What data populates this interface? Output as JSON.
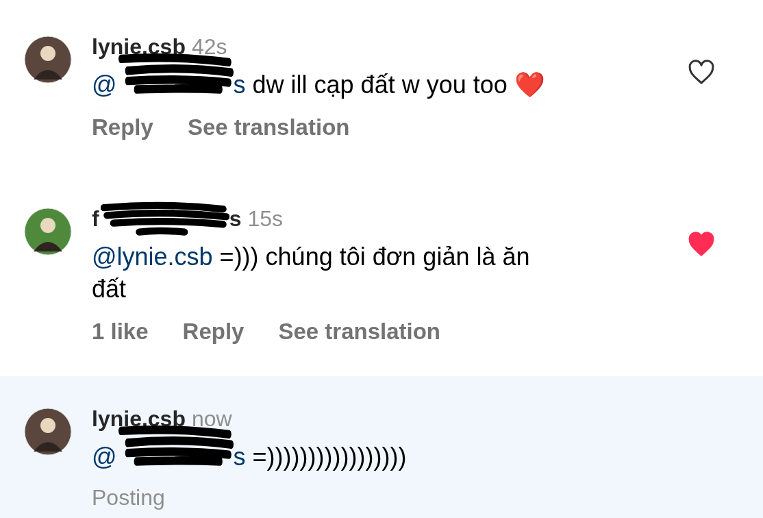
{
  "comments": [
    {
      "avatar": {
        "color": "#5a463c"
      },
      "username": [
        {
          "kind": "text",
          "text": "lynie.csb"
        }
      ],
      "time": "42s",
      "body": [
        {
          "kind": "mention",
          "text": "@"
        },
        {
          "kind": "redacted"
        },
        {
          "kind": "mention",
          "text": "s"
        },
        {
          "kind": "text",
          "text": " dw ill cạp đất w you too "
        },
        {
          "kind": "emoji",
          "text": "❤️"
        }
      ],
      "actions": [
        "Reply",
        "See translation"
      ],
      "like_button": {
        "liked": false
      },
      "highlighted": false
    },
    {
      "avatar": {
        "color": "#4f8a3c"
      },
      "username": [
        {
          "kind": "text",
          "text": "f"
        },
        {
          "kind": "redacted"
        },
        {
          "kind": "text",
          "text": "s"
        }
      ],
      "time": "15s",
      "body": [
        {
          "kind": "mention",
          "text": "@lynie.csb"
        },
        {
          "kind": "text",
          "text": " =))) chúng tôi đơn giản là ăn đất"
        }
      ],
      "actions": [
        "1 like",
        "Reply",
        "See translation"
      ],
      "like_button": {
        "liked": true
      },
      "highlighted": false
    },
    {
      "avatar": {
        "color": "#5a463c"
      },
      "username": [
        {
          "kind": "text",
          "text": "lynie.csb"
        }
      ],
      "time": "now",
      "body": [
        {
          "kind": "mention",
          "text": "@"
        },
        {
          "kind": "redacted"
        },
        {
          "kind": "mention",
          "text": "s"
        },
        {
          "kind": "text",
          "text": " =)))))))))))))))))"
        }
      ],
      "status": "Posting",
      "highlighted": true
    }
  ]
}
